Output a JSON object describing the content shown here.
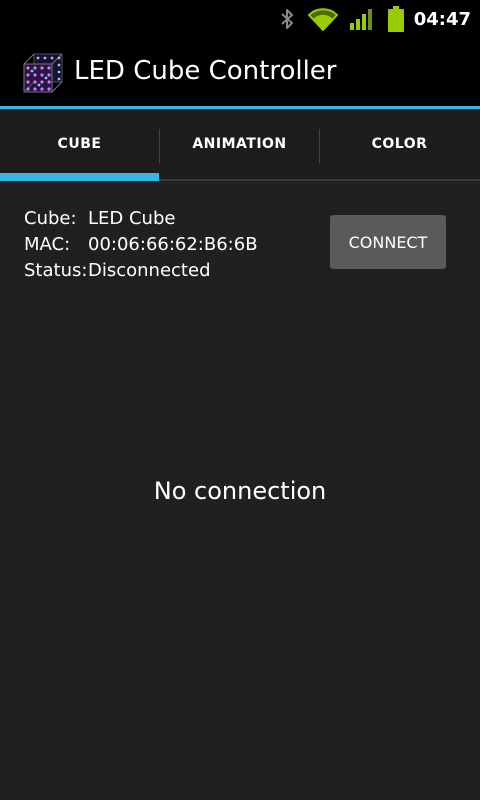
{
  "status_bar": {
    "time": "04:47",
    "icons": [
      "bluetooth-icon",
      "wifi-icon",
      "signal-icon",
      "battery-icon"
    ],
    "accent_color": "#99cc00"
  },
  "action_bar": {
    "title": "LED Cube Controller",
    "app_icon": "led-cube-icon",
    "accent_color": "#33b5e5"
  },
  "tabs": [
    {
      "label": "CUBE",
      "selected": true
    },
    {
      "label": "ANIMATION",
      "selected": false
    },
    {
      "label": "COLOR",
      "selected": false
    }
  ],
  "device": {
    "cube_label": "Cube:",
    "cube_value": "LED Cube",
    "mac_label": "MAC:",
    "mac_value": "00:06:66:62:B6:6B",
    "status_label": "Status:",
    "status_value": "Disconnected"
  },
  "connect_button": {
    "label": "CONNECT"
  },
  "message": "No connection"
}
